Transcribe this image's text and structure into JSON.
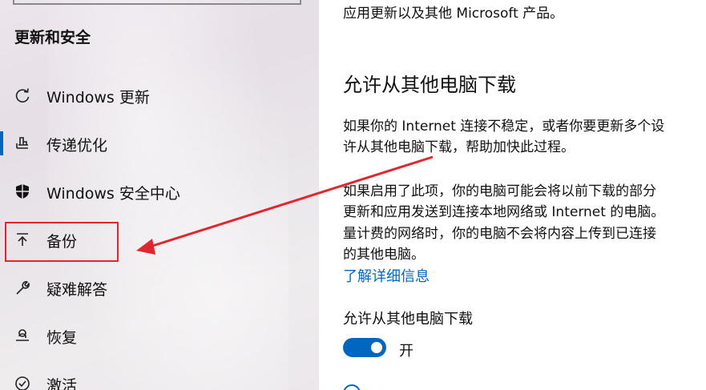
{
  "sidebar": {
    "section_title": "更新和安全",
    "items": [
      {
        "label": "Windows 更新",
        "icon": "refresh-icon"
      },
      {
        "label": "传递优化",
        "icon": "delivery-optimization-icon"
      },
      {
        "label": "Windows 安全中心",
        "icon": "shield-icon"
      },
      {
        "label": "备份",
        "icon": "backup-arrow-up-icon"
      },
      {
        "label": "疑难解答",
        "icon": "wrench-icon"
      },
      {
        "label": "恢复",
        "icon": "recovery-icon"
      },
      {
        "label": "激活",
        "icon": "check-circle-icon"
      }
    ],
    "selected": "传递优化"
  },
  "content": {
    "top_text": "应用更新以及其他 Microsoft 产品。",
    "heading": "允许从其他电脑下载",
    "para1_line1": "如果你的 Internet 连接不稳定，或者你要更新多个设",
    "para1_line2": "许从其他电脑下载，帮助加快此过程。",
    "para2_line1": "如果启用了此项，你的电脑可能会将以前下载的部分",
    "para2_line2": "更新和应用发送到连接本地网络或 Internet 的电脑。",
    "para2_line3": "量计费的网络时，你的电脑不会将内容上传到已连接",
    "para2_line4": "的其他电脑。",
    "link": "了解详细信息",
    "toggle_label": "允许从其他电脑下载",
    "toggle_state": "开"
  },
  "colors": {
    "accent": "#0067c0",
    "annotation_red": "#e0262e"
  }
}
